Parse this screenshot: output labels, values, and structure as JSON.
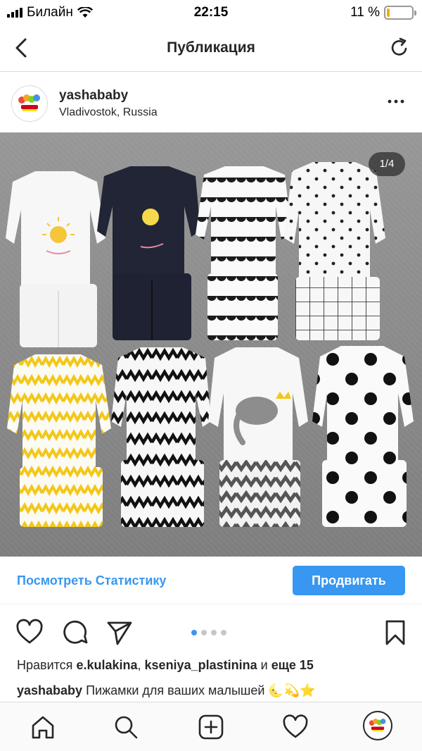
{
  "status_bar": {
    "carrier": "Билайн",
    "time": "22:15",
    "battery_text": "11 %",
    "battery_level": 0.11
  },
  "nav": {
    "title": "Публикация",
    "back_icon": "chevron-left-icon",
    "refresh_icon": "refresh-icon"
  },
  "post": {
    "username": "yashababy",
    "location": "Vladivostok, Russia",
    "more_icon": "ellipsis-icon",
    "image_counter": "1/4",
    "image_count": 4,
    "active_image": 1
  },
  "promo": {
    "stats_link": "Посмотреть Статистику",
    "promote_button": "Продвигать"
  },
  "actions": {
    "like_icon": "heart-icon",
    "comment_icon": "comment-icon",
    "share_icon": "send-icon",
    "save_icon": "bookmark-icon"
  },
  "likes": {
    "prefix": "Нравится",
    "user1": "e.kulakina",
    "separator": ",",
    "user2": "kseniya_plastinina",
    "and": "и",
    "more": "еще 15"
  },
  "caption": {
    "username": "yashababy",
    "text": "Пижамки для ваших малышей",
    "emoji": "🌜💫⭐"
  },
  "tabbar": {
    "items": [
      "home-icon",
      "search-icon",
      "add-post-icon",
      "activity-heart-icon",
      "profile-avatar"
    ]
  },
  "colors": {
    "accent": "#3897f0",
    "text": "#262626",
    "border": "#dbdbdb"
  }
}
